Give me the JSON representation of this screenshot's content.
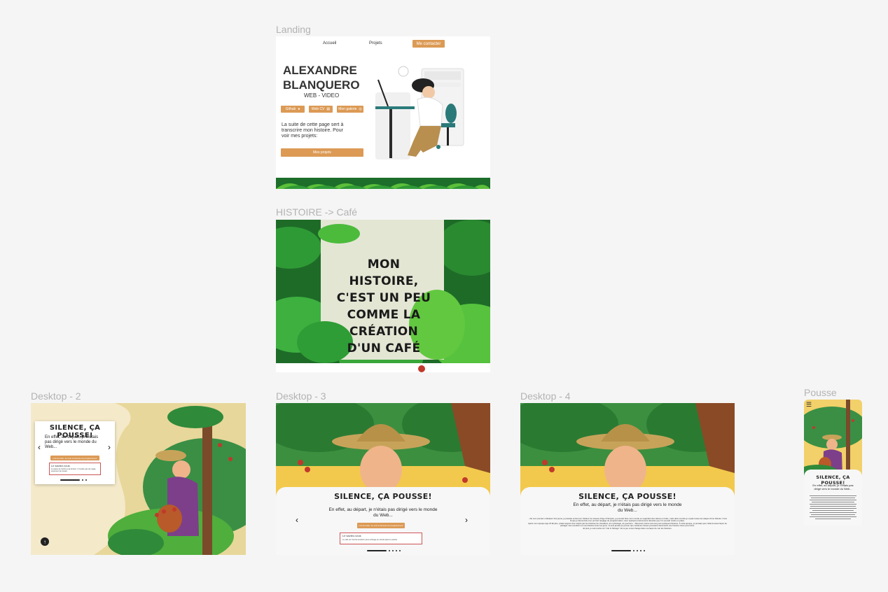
{
  "frames": {
    "landing": {
      "label": "Landing",
      "nav": [
        "Accueil",
        "Projets",
        "Me contacter"
      ],
      "name_line1": "ALEXANDRE",
      "name_line2": "BLANQUERO",
      "subtitle": "WEB - VIDEO",
      "chips": [
        "Github",
        "Web CV",
        "Mon galerie"
      ],
      "intro": "La suite de cette page sert à transcrire mon histoire. Pour voir mes projets:",
      "cta": "Mes projets"
    },
    "histoire": {
      "label": "HISTOIRE -> Café",
      "quote": [
        "MON HISTOIRE,",
        "C'EST UN PEU",
        "COMME LA",
        "CRÉATION",
        "D'UN CAFÉ"
      ]
    },
    "desktop2": {
      "label": "Desktop - 2",
      "title": "SILENCE, ÇA POUSSE!",
      "text": "En effet, au départ, je n'étais pas dirigé vers le monde du Web...",
      "button": "Lire la suite: Je suis à l'écoute du programmeur",
      "box_title": "Le saviez-vous",
      "box_text": "Je passe de l'ombre à la lumière. Il n'existe pas de magie, seulement du travail."
    },
    "desktop3": {
      "label": "Desktop - 3",
      "title": "SILENCE, ÇA POUSSE!",
      "text": "En effet, au départ, je n'étais pas dirigé vers le monde du Web...",
      "button": "Lire la suite: Je suis à l'écoute du programmeur",
      "box_title": "Le saviez-vous",
      "box_text": "Le café est l'ouvrier produit le plus échangé au monde après le pétrole."
    },
    "desktop4": {
      "label": "Desktop - 4",
      "title": "SILENCE, ÇA POUSSE!",
      "text": "En effet, au départ, je n'étais pas dirigé vers le monde du Web...",
      "body1": "...De mon premier ordinateur très jeune, je passais surtout sur l'éditeur de niveaux d'Age Of Empire, je pouvais faire mon monde en regardant des vidéos en boîte, mais dans ma tête je voyais toutes les étapes d'une histoire. C'est là que je découvrais mon premier langage de programmation, avec quelques événements déroulés que l'on pouvait mettre en place.",
      "body2": "Après mon époque Age Of Empire, j'étais toujours très inspiré par les histoires de chevaliers, de mythologie, de guerriers... Rarement même tous les jours quelques histoires. À cette époque, je pensais que c'était la seule façon de partager mes émotions et mes histoires avec les gens. Je suis jamais pu penser que certaines choses pouvaient transmettre une histoire mieux qu'un livre.",
      "body3": "Et puis, je suis tombé sur \"Life Is Strange\". Et ce jeu a tout changé dans ma façon de voir les histoires."
    },
    "pousse": {
      "label": "Pousse",
      "title": "SILENCE, ÇA POUSSE!",
      "text": "En effet, au départ, je n'étais pas dirigé vers le monde du Web..."
    }
  },
  "colors": {
    "background": "#f5f5f5",
    "accent": "#dc9a55",
    "leaf_dark": "#1f7a2a",
    "leaf_light": "#6cc24a",
    "paper": "#e4e6d4"
  }
}
